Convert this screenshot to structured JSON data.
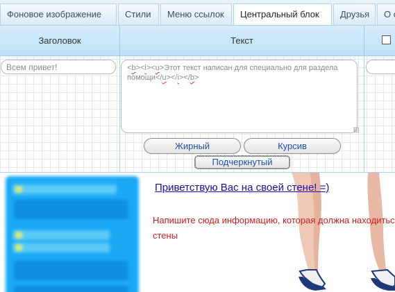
{
  "tabs": [
    {
      "label": "Фоновое изображение",
      "active": false
    },
    {
      "label": "Стили",
      "active": false
    },
    {
      "label": "Меню ссылок",
      "active": false
    },
    {
      "label": "Центральный блок",
      "active": true
    },
    {
      "label": "Друзья",
      "active": false
    },
    {
      "label": "О с",
      "active": false
    }
  ],
  "columns": {
    "title_header": "Заголовок",
    "text_header": "Текст"
  },
  "form": {
    "title_value": "Всем привет!",
    "text_value_parts": [
      {
        "t": "<",
        "sq": false
      },
      {
        "t": "b",
        "sq": true
      },
      {
        "t": "><",
        "sq": false
      },
      {
        "t": "i",
        "sq": true
      },
      {
        "t": "><",
        "sq": false
      },
      {
        "t": "u",
        "sq": true
      },
      {
        "t": ">Этот текст написан для специально для раздела помощи</",
        "sq": false
      },
      {
        "t": "u",
        "sq": true
      },
      {
        "t": "></",
        "sq": false
      },
      {
        "t": "i",
        "sq": true
      },
      {
        "t": "></",
        "sq": false
      },
      {
        "t": "b",
        "sq": true
      },
      {
        "t": ">",
        "sq": false
      }
    ]
  },
  "buttons": {
    "bold": "Жирный",
    "italic": "Курсив",
    "underline": "Подчеркнутый"
  },
  "preview": {
    "greeting": "Приветствую Вас на своей стене! =)",
    "info_line1": "Напишите сюда информацию, которая должна находиться",
    "info_line2": "стены"
  },
  "colors": {
    "accent_blue": "#1aa9f5",
    "link": "#1a0dab",
    "info_red": "#d21b1b",
    "header_bg": "#bfe1f8"
  }
}
